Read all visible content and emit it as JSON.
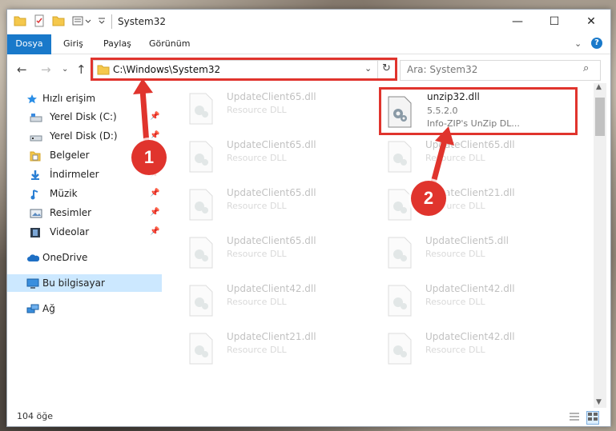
{
  "window": {
    "title": "System32",
    "controls": {
      "minimize": "—",
      "maximize": "☐",
      "close": "✕"
    }
  },
  "ribbon": {
    "tabs": [
      {
        "label": "Dosya",
        "active": true
      },
      {
        "label": "Giriş"
      },
      {
        "label": "Paylaş"
      },
      {
        "label": "Görünüm"
      }
    ]
  },
  "navigation": {
    "address": "C:\\Windows\\System32",
    "search_placeholder": "Ara: System32"
  },
  "sidebar": {
    "quick_access": "Hızlı erişim",
    "items": [
      {
        "label": "Yerel Disk (C:)",
        "icon": "drive-icon",
        "pinned": true
      },
      {
        "label": "Yerel Disk (D:)",
        "icon": "drive-icon",
        "pinned": true
      },
      {
        "label": "Belgeler",
        "icon": "documents-icon",
        "pinned": true
      },
      {
        "label": "İndirmeler",
        "icon": "downloads-icon",
        "pinned": true
      },
      {
        "label": "Müzik",
        "icon": "music-icon",
        "pinned": true
      },
      {
        "label": "Resimler",
        "icon": "pictures-icon",
        "pinned": true
      },
      {
        "label": "Videolar",
        "icon": "videos-icon",
        "pinned": true
      }
    ],
    "onedrive": "OneDrive",
    "this_pc": "Bu bilgisayar",
    "network": "Ağ"
  },
  "files": {
    "highlighted": {
      "name": "unzip32.dll",
      "version": "5.5.2.0",
      "description": "Info-ZIP's UnZip DL..."
    },
    "left_column": [
      {
        "name": "UpdateClient65.dll",
        "type": "Resource DLL"
      },
      {
        "name": "UpdateClient65.dll",
        "type": "Resource DLL"
      },
      {
        "name": "UpdateClient65.dll",
        "type": "Resource DLL"
      },
      {
        "name": "UpdateClient65.dll",
        "type": "Resource DLL"
      },
      {
        "name": "UpdateClient42.dll",
        "type": "Resource DLL"
      },
      {
        "name": "UpdateClient21.dll",
        "type": "Resource DLL"
      }
    ],
    "right_column": [
      {
        "name": "UpdateClient65.dll",
        "type": "Resource DLL"
      },
      {
        "name": "UpdateClient21.dll",
        "type": "Resource DLL"
      },
      {
        "name": "UpdateClient5.dll",
        "type": "Resource DLL"
      },
      {
        "name": "UpdateClient42.dll",
        "type": "Resource DLL"
      },
      {
        "name": "UpdateClient42.dll",
        "type": "Resource DLL"
      }
    ]
  },
  "status": {
    "item_count": "104 öğe"
  },
  "annotations": {
    "step1": "1",
    "step2": "2",
    "color": "#e0342d"
  }
}
